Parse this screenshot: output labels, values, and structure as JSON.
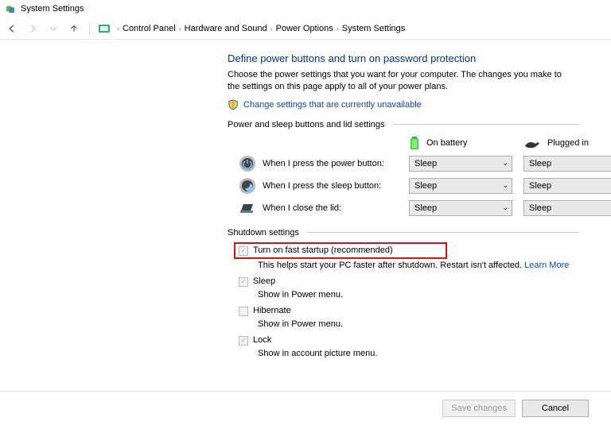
{
  "window": {
    "title": "System Settings"
  },
  "breadcrumb": {
    "items": [
      "Control Panel",
      "Hardware and Sound",
      "Power Options",
      "System Settings"
    ]
  },
  "header": {
    "title": "Define power buttons and turn on password protection",
    "description": "Choose the power settings that you want for your computer. The changes you make to the settings on this page apply to all of your power plans.",
    "change_link": "Change settings that are currently unavailable"
  },
  "section_power": {
    "legend": "Power and sleep buttons and lid settings",
    "col_battery": "On battery",
    "col_plugged": "Plugged in",
    "rows": [
      {
        "label": "When I press the power button:",
        "battery": "Sleep",
        "plugged": "Sleep"
      },
      {
        "label": "When I press the sleep button:",
        "battery": "Sleep",
        "plugged": "Sleep"
      },
      {
        "label": "When I close the lid:",
        "battery": "Sleep",
        "plugged": "Sleep"
      }
    ]
  },
  "section_shutdown": {
    "legend": "Shutdown settings",
    "fast_startup": {
      "label": "Turn on fast startup (recommended)",
      "sub": "This helps start your PC faster after shutdown. Restart isn't affected.",
      "learn": "Learn More"
    },
    "sleep": {
      "label": "Sleep",
      "sub": "Show in Power menu."
    },
    "hibernate": {
      "label": "Hibernate",
      "sub": "Show in Power menu."
    },
    "lock": {
      "label": "Lock",
      "sub": "Show in account picture menu."
    }
  },
  "footer": {
    "save": "Save changes",
    "cancel": "Cancel"
  }
}
